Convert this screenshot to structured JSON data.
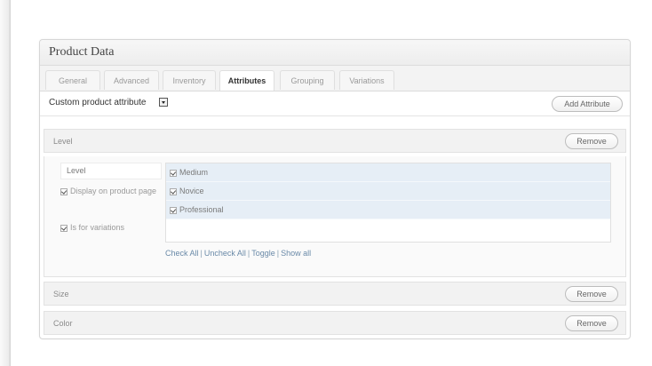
{
  "panel": {
    "title": "Product Data",
    "tabs": [
      "General",
      "Advanced",
      "Inventory",
      "Attributes",
      "Grouping",
      "Variations"
    ],
    "active_tab": "Attributes"
  },
  "toolbar": {
    "select_label": "Custom product attribute",
    "add_button": "Add Attribute"
  },
  "attributes": [
    {
      "name": "Level",
      "remove_label": "Remove",
      "expanded": true,
      "name_value": "Level",
      "options": [
        {
          "label": "Display on product page",
          "checked": true
        },
        {
          "label": "Is for variations",
          "checked": true
        }
      ],
      "values": [
        {
          "label": "Medium",
          "checked": true
        },
        {
          "label": "Novice",
          "checked": true
        },
        {
          "label": "Professional",
          "checked": true
        }
      ],
      "links": [
        "Check All",
        "Uncheck All",
        "Toggle",
        "Show all"
      ]
    },
    {
      "name": "Size",
      "remove_label": "Remove",
      "expanded": false
    },
    {
      "name": "Color",
      "remove_label": "Remove",
      "expanded": false
    }
  ],
  "colors": {
    "link": "#6a8aa8",
    "selected_value_bg": "#e6eef6"
  },
  "icons": {
    "select": "dropdown-arrow-icon",
    "checkbox": "checkbox-checked-icon"
  }
}
